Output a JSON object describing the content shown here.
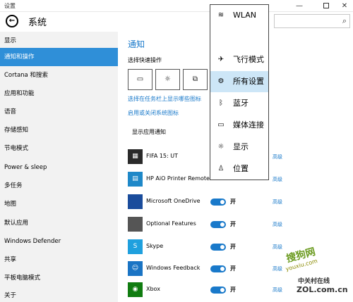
{
  "window": {
    "title": "设置",
    "min": "—",
    "close": "✕"
  },
  "header": {
    "back_glyph": "←",
    "title": "系统",
    "search_icon": "search-icon"
  },
  "sidebar": {
    "items": [
      {
        "label": "显示"
      },
      {
        "label": "通知和操作",
        "active": true
      },
      {
        "label": "Cortana 和搜索"
      },
      {
        "label": "应用和功能"
      },
      {
        "label": "语音"
      },
      {
        "label": "存储感知"
      },
      {
        "label": "节电模式"
      },
      {
        "label": "Power & sleep"
      },
      {
        "label": "多任务"
      },
      {
        "label": "地图"
      },
      {
        "label": "默认应用"
      },
      {
        "label": "Windows Defender"
      },
      {
        "label": "共享"
      },
      {
        "label": "平板电脑模式"
      },
      {
        "label": "关于"
      }
    ]
  },
  "main": {
    "title": "通知",
    "quick_actions_label": "选择快速操作",
    "quick_actions": [
      {
        "icon": "tablet-mode-icon",
        "glyph": "▭"
      },
      {
        "icon": "brightness-icon",
        "glyph": "☼"
      },
      {
        "icon": "connect-icon",
        "glyph": "⧉"
      }
    ],
    "link_taskbar": "选择在任务栏上显示哪些图标",
    "link_system_icons": "启用或关闭系统图标",
    "show_notifications_label": "显示应用通知",
    "apps": [
      {
        "name": "FIFA 15: UT",
        "color": "#2a2a2a",
        "glyph": "▦",
        "toggle": "",
        "advanced": "高级"
      },
      {
        "name": "HP AiO Printer Remote",
        "color": "#1e88c8",
        "glyph": "▤",
        "toggle": "",
        "advanced": "高级"
      },
      {
        "name": "Microsoft OneDrive",
        "color": "#1a4c9c",
        "glyph": "",
        "toggle": "开",
        "advanced": "高级"
      },
      {
        "name": "Optional Features",
        "color": "#555555",
        "glyph": "",
        "toggle": "开",
        "advanced": "高级"
      },
      {
        "name": "Skype",
        "color": "#1fa0de",
        "glyph": "S",
        "toggle": "开",
        "advanced": "高级"
      },
      {
        "name": "Windows Feedback",
        "color": "#1a74c4",
        "glyph": "☺",
        "toggle": "开",
        "advanced": "高级"
      },
      {
        "name": "Xbox",
        "color": "#107c10",
        "glyph": "◉",
        "toggle": "开",
        "advanced": "高级"
      }
    ]
  },
  "popup_menu": {
    "items": [
      {
        "label": "WLAN",
        "icon": "wifi-icon",
        "glyph": "≋"
      },
      {
        "label": "飞行模式",
        "icon": "airplane-icon",
        "glyph": "✈"
      },
      {
        "label": "所有设置",
        "icon": "gear-icon",
        "glyph": "⚙",
        "highlighted": true
      },
      {
        "label": "蓝牙",
        "icon": "bluetooth-icon",
        "glyph": "ᛒ"
      },
      {
        "label": "媒体连接",
        "icon": "project-icon",
        "glyph": "▭"
      },
      {
        "label": "显示",
        "icon": "brightness-icon",
        "glyph": "☼"
      },
      {
        "label": "位置",
        "icon": "location-icon",
        "glyph": "♙"
      }
    ]
  },
  "watermark": {
    "line1": "搜狗网",
    "line2": "youxiu.com",
    "line3": "中关村在线",
    "line4": "ZOL.com.cn"
  }
}
